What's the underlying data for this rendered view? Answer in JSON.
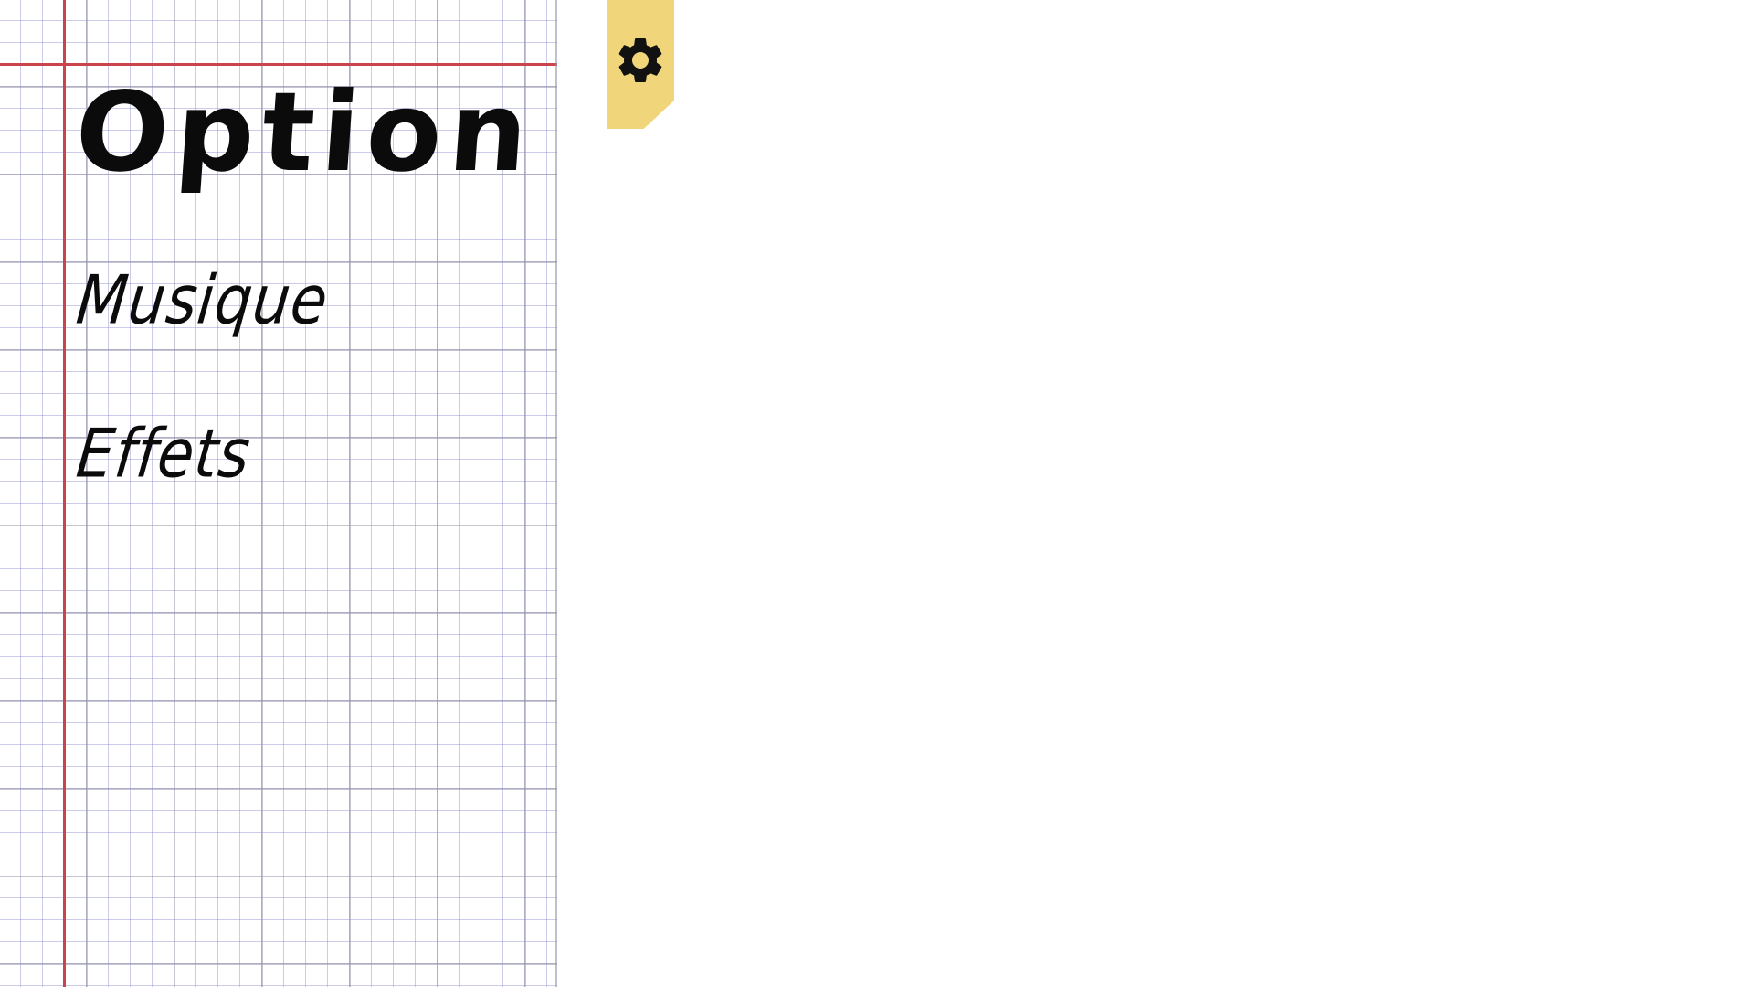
{
  "panel": {
    "title": "Option",
    "items": [
      {
        "label": "Musique"
      },
      {
        "label": "Effets"
      }
    ]
  },
  "settings_tab": {
    "icon": "gear-icon",
    "color": "#f0d57a"
  },
  "colors": {
    "margin_line": "#c9454b",
    "ink": "#0b0b0b"
  }
}
